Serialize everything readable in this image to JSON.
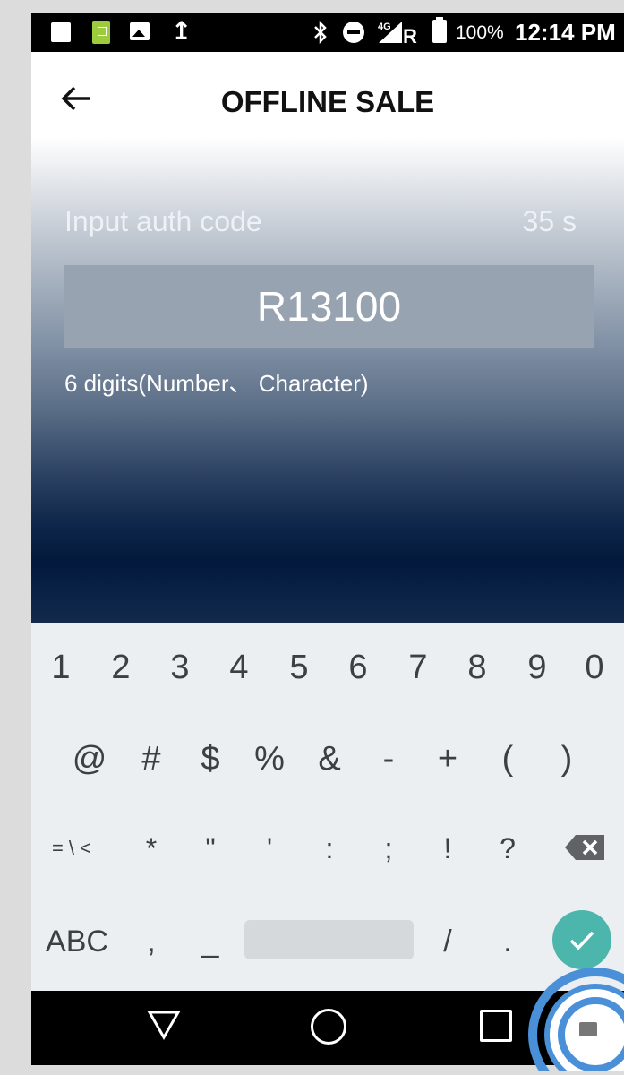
{
  "status_bar": {
    "battery_percent": "100%",
    "network": "4G",
    "roaming": "R",
    "time": "12:14 PM"
  },
  "app_bar": {
    "title": "OFFLINE SALE"
  },
  "auth": {
    "label": "Input auth code",
    "countdown": "35 s",
    "code_value": "R13100",
    "hint": "6 digits(Number、 Character)"
  },
  "keyboard": {
    "row1": [
      "1",
      "2",
      "3",
      "4",
      "5",
      "6",
      "7",
      "8",
      "9",
      "0"
    ],
    "row2": [
      "@",
      "#",
      "$",
      "%",
      "&",
      "-",
      "+",
      "(",
      ")"
    ],
    "row3": [
      "= \\ <",
      "*",
      "\"",
      "'",
      ":",
      ";",
      "!",
      "?"
    ],
    "abc_label": "ABC",
    "row4": [
      ",",
      "_",
      "/",
      "."
    ]
  },
  "colors": {
    "accent": "#4db6ac",
    "keyboard_bg": "#eceff1",
    "key_text": "#3c4043"
  },
  "icons": {
    "back": "arrow-left-icon",
    "backspace": "backspace-icon",
    "enter": "check-icon",
    "nav_back": "triangle-back-icon",
    "nav_home": "circle-home-icon",
    "nav_recents": "square-recents-icon"
  }
}
